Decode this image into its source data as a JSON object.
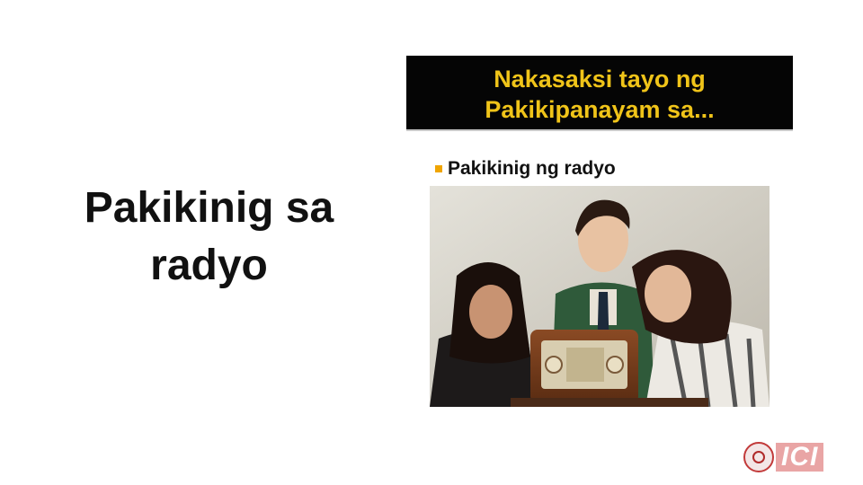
{
  "slide": {
    "title_line1": "Pakikinig sa",
    "title_line2": "radyo"
  },
  "panel": {
    "header_line1": "Nakasaksi tayo ng",
    "header_line2": "Pakikipanayam sa...",
    "bullet": "Pakikinig ng radyo"
  },
  "photo": {
    "subject": "Three young people leaning in, listening to a vintage wooden radio"
  },
  "logo": {
    "text": "ICI"
  },
  "colors": {
    "header_bg": "#050505",
    "header_text": "#f0c419",
    "bullet_mark": "#f0a500",
    "logo_accent": "#c23a3a"
  }
}
